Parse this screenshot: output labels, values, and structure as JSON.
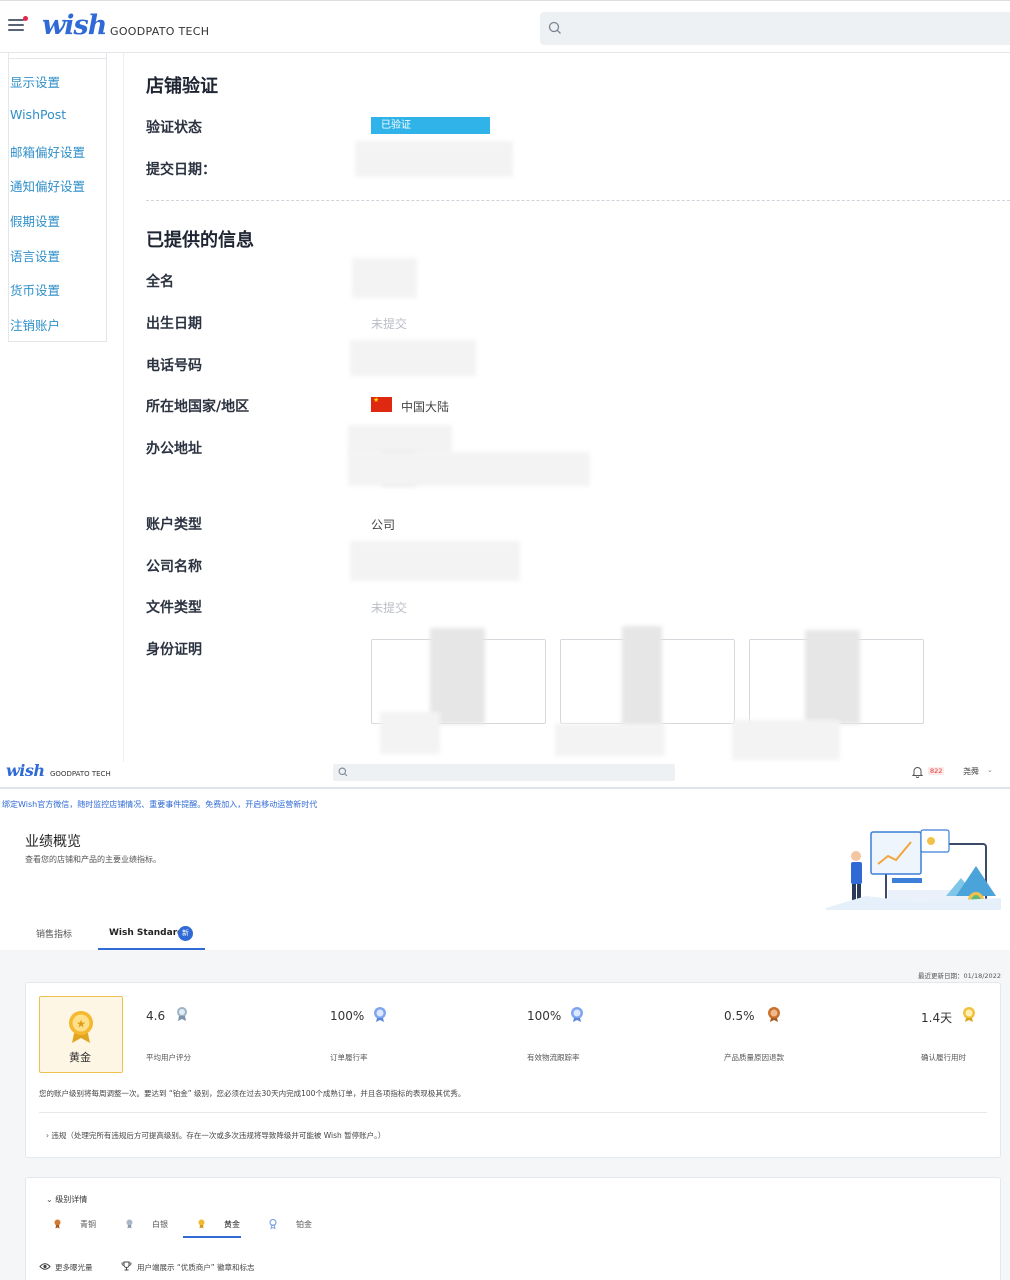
{
  "top": {
    "header": {
      "logo": "wish",
      "brand": "GOODPATO TECH"
    },
    "sidebar": {
      "items": [
        "显示设置",
        "WishPost",
        "邮箱偏好设置",
        "通知偏好设置",
        "假期设置",
        "语言设置",
        "货币设置",
        "注销账户"
      ]
    },
    "verification": {
      "title": "店铺验证",
      "status_label": "验证状态",
      "status_value": "已验证",
      "submit_date_label": "提交日期："
    },
    "info": {
      "title": "已提供的信息",
      "full_name_label": "全名",
      "dob_label": "出生日期",
      "dob_value": "未提交",
      "phone_label": "电话号码",
      "country_label": "所在地国家/地区",
      "country_value": "中国大陆",
      "office_label": "办公地址",
      "account_type_label": "账户类型",
      "account_type_value": "公司",
      "company_label": "公司名称",
      "doc_type_label": "文件类型",
      "doc_type_value": "未提交",
      "id_label": "身份证明"
    }
  },
  "bottom": {
    "header": {
      "logo": "wish",
      "brand": "GOODPATO TECH",
      "notif_count": "822",
      "user": "尧舜"
    },
    "banner": "绑定Wish官方微信，随时监控店铺情况、重要事件提醒。免费加入，开启移动运营新时代",
    "overview": {
      "title": "业绩概览",
      "subtitle": "查看您的店铺和产品的主要业绩指标。"
    },
    "tabs": {
      "sales": "销售指标",
      "standards": "Wish Standards",
      "new_badge": "新"
    },
    "updated": "最近更新日期：01/18/2022",
    "tier": "黄金",
    "metrics": [
      {
        "value": "4.6",
        "label": "平均用户评分"
      },
      {
        "value": "100%",
        "label": "订单履行率"
      },
      {
        "value": "100%",
        "label": "有效物流跟踪率"
      },
      {
        "value": "0.5%",
        "label": "产品质量原因退款"
      },
      {
        "value": "1.4天",
        "label": "确认履行用时"
      }
    ],
    "note": "您的账户级别将每周调整一次。要达到 “铂金” 级别，您必须在过去30天内完成100个成熟订单，并且各项指标的表现极其优秀。",
    "violation": "违规（处理完所有违规后方可提高级别。存在一次或多次违规将导致降级并可能被 Wish 暂停账户。）",
    "levels": {
      "title": "级别详情",
      "tabs": [
        "青铜",
        "白银",
        "黄金",
        "铂金"
      ],
      "benefits": [
        "更多曝光量",
        "用户端展示 “优质商户” 徽章和标志"
      ]
    },
    "colors": {
      "accent": "#2f6ad6",
      "verified": "#2fb3e8",
      "gold": "#f0c250"
    }
  }
}
